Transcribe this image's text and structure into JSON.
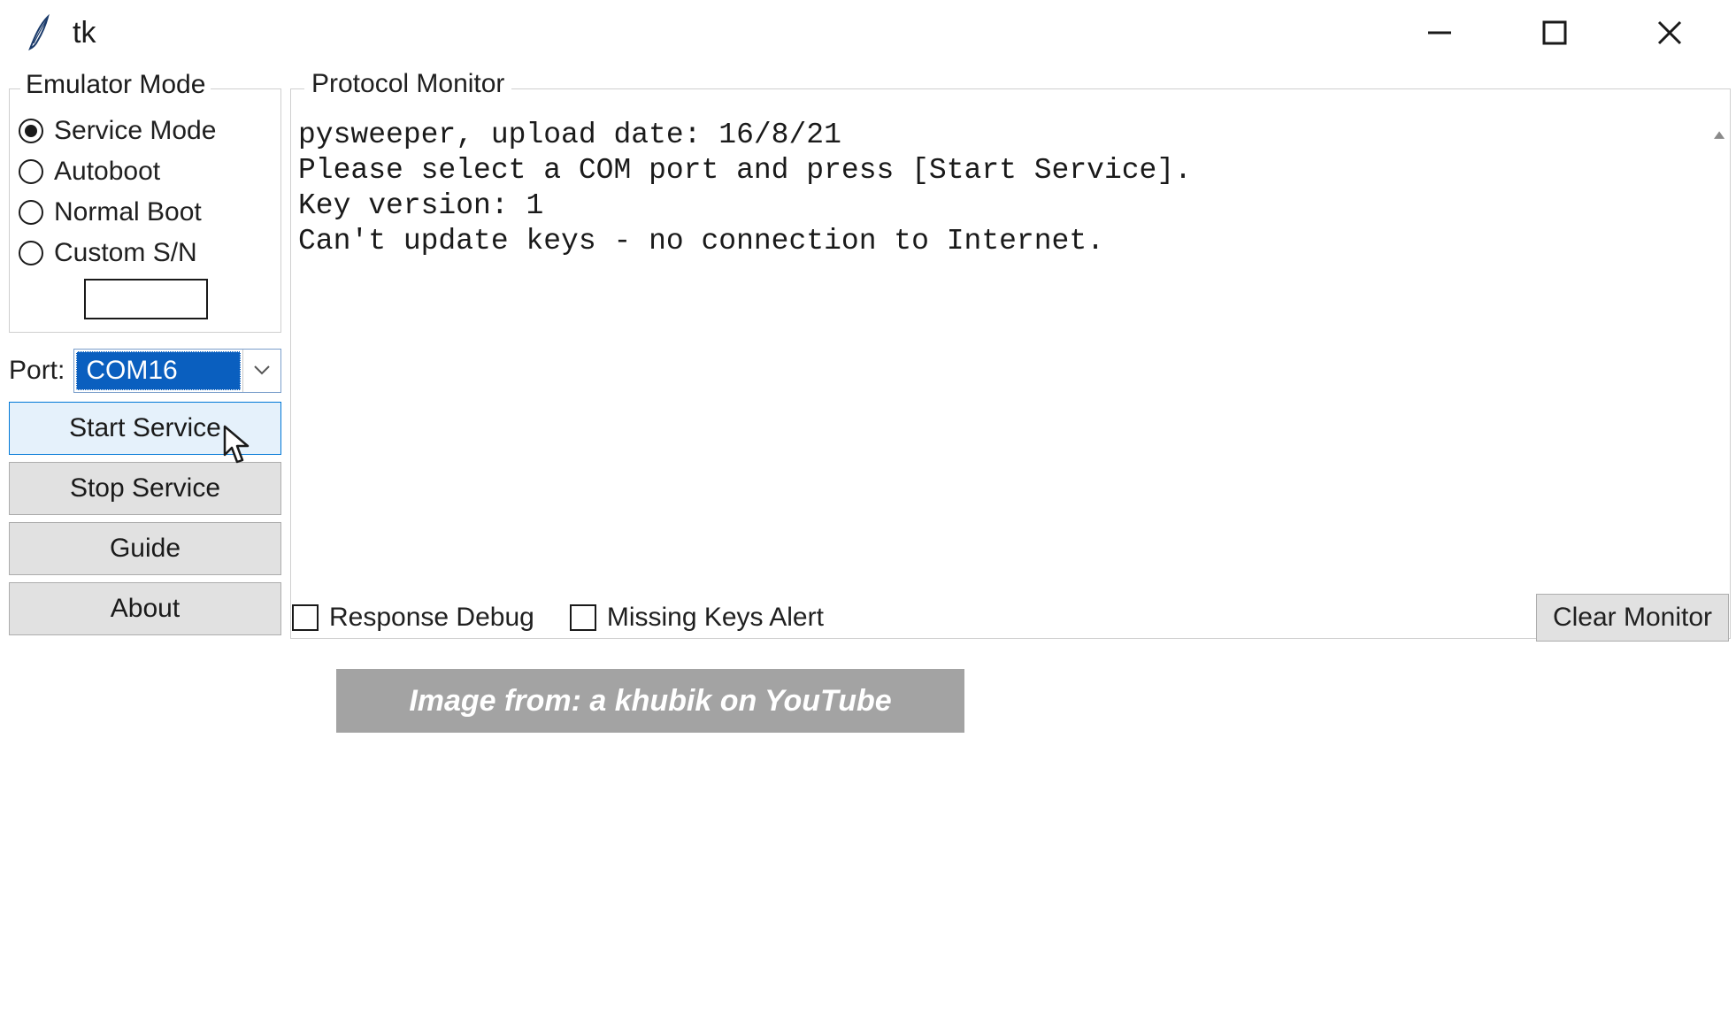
{
  "window": {
    "title": "tk"
  },
  "emulator": {
    "legend": "Emulator Mode",
    "options": {
      "service": "Service Mode",
      "autoboot": "Autoboot",
      "normal": "Normal Boot",
      "custom": "Custom S/N"
    },
    "selected": "service",
    "custom_sn_value": ""
  },
  "port": {
    "label": "Port:",
    "selected": "COM16"
  },
  "buttons": {
    "start": "Start Service",
    "stop": "Stop Service",
    "guide": "Guide",
    "about": "About",
    "clear": "Clear Monitor"
  },
  "monitor": {
    "legend": "Protocol Monitor",
    "text": "pysweeper, upload date: 16/8/21\nPlease select a COM port and press [Start Service].\nKey version: 1\nCan't update keys - no connection to Internet."
  },
  "checks": {
    "response_debug": {
      "label": "Response Debug",
      "checked": false
    },
    "missing_keys": {
      "label": "Missing Keys Alert",
      "checked": false
    }
  },
  "caption": "Image from: a khubik on YouTube"
}
